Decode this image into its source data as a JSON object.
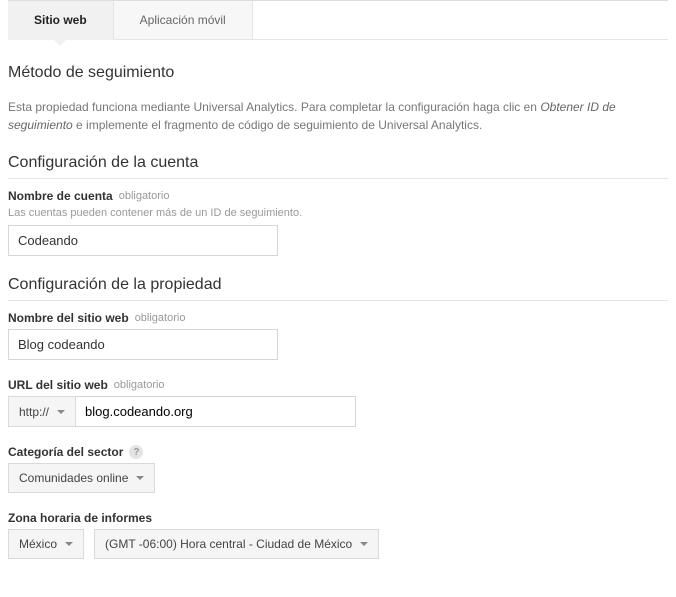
{
  "tabs": {
    "website": "Sitio web",
    "mobile": "Aplicación móvil"
  },
  "tracking": {
    "title": "Método de seguimiento",
    "desc_pre": "Esta propiedad funciona mediante Universal Analytics. Para completar la configuración haga clic en ",
    "desc_em": "Obtener ID de seguimiento",
    "desc_post": " e implemente el fragmento de código de seguimiento de Universal Analytics."
  },
  "account": {
    "title": "Configuración de la cuenta",
    "name_label": "Nombre de cuenta",
    "name_req": "obligatorio",
    "name_hint": "Las cuentas pueden contener más de un ID de seguimiento.",
    "name_value": "Codeando"
  },
  "property": {
    "title": "Configuración de la propiedad",
    "site_label": "Nombre del sitio web",
    "site_req": "obligatorio",
    "site_value": "Blog codeando",
    "url_label": "URL del sitio web",
    "url_req": "obligatorio",
    "url_scheme": "http://",
    "url_value": "blog.codeando.org",
    "category_label": "Categoría del sector",
    "category_value": "Comunidades online",
    "tz_label": "Zona horaria de informes",
    "tz_country": "México",
    "tz_value": "(GMT -06:00) Hora central - Ciudad de México"
  }
}
